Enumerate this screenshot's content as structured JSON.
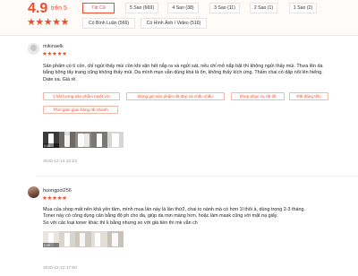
{
  "summary": {
    "rating": "4.9",
    "rating_suffix": "trên 5",
    "stars": "★★★★★",
    "filters": [
      "Tất Cả",
      "5 Sao (669)",
      "4 Sao (38)",
      "3 Sao (11)",
      "2 Sao (1)",
      "1 Sao (2)",
      "Có Bình Luận (566)",
      "Có Hình Ảnh / Video (516)"
    ]
  },
  "reviews": [
    {
      "username": "mikinaelk",
      "stars": "★★★★★",
      "lines": [
        "Sản phẩm có tí cồn, chỉ ngửi thấy mùi cồn khi vặn hết nắp ra và ngửi sát, nếu chỉ mở nắp bật thì không ngửi thấy mùi. Thưa lên da",
        "bằng bông tẩy trang cũng không thấy mùi. Da mình mụn vẫn dùng khá là ổn, không thấy kích ứng. Thấm chai có dập nổi lên hiếng.",
        "Date xa. Giá rẻ."
      ],
      "tags": [
        "Chất lượng sản phẩm tuyệt vời",
        "Đóng gói sản phẩm rất đẹp và chắc chắn",
        "Shop phục vụ rất tốt",
        "Rất đáng tiền",
        "Thời gian giao hàng rất nhanh"
      ],
      "video_duration": "0:06",
      "date": "2020-12-14 22:23"
    },
    {
      "username": "huongpol256",
      "stars": "★★★★★",
      "lines": [
        "Mua của shop mất nên khá yên tâm, mình mua lần này là lần thứ2, chai to oánh mà có hơn 1l thôi à, dùng trong 2-3 tháng.",
        "Toner này có công dụng cân bằng độ ph cho da, giúp da mịn màng hơn, hoặc làm mask cũng với mặt nạ giấy.",
        "So với các loại toner khác thì k bằng nhưng so với giá tiền thì mk vẫn ch"
      ],
      "video_duration": "0:09",
      "date": "2020-12-12 17:50"
    }
  ]
}
